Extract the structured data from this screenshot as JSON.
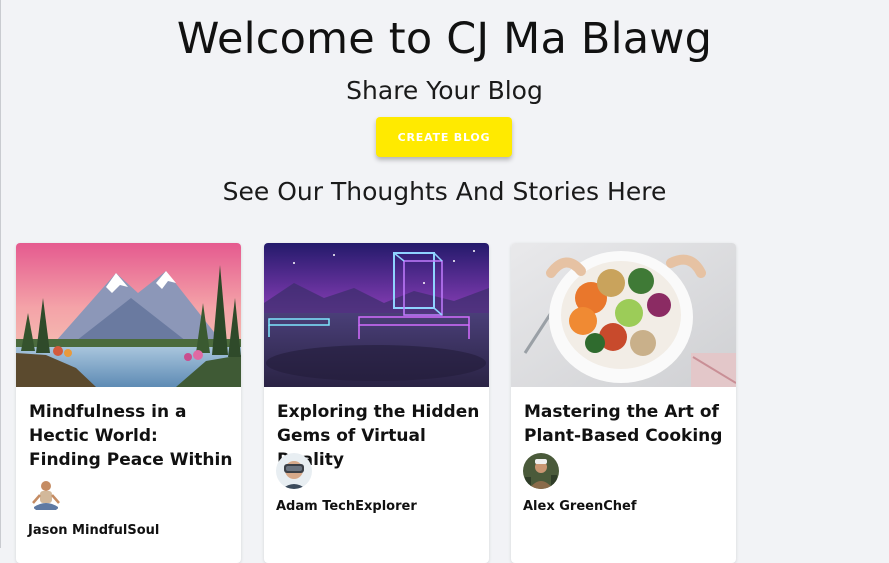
{
  "hero": {
    "title": "Welcome to CJ Ma Blawg",
    "subtitle": "Share Your Blog",
    "create_button_label": "CREATE BLOG",
    "section_heading": "See Our Thoughts And Stories Here"
  },
  "posts": [
    {
      "title": "Mindfulness in a Hectic World: Finding Peace Within",
      "author": "Jason MindfulSoul",
      "image": "mountain-lake-image",
      "avatar": "meditating-person-avatar"
    },
    {
      "title": "Exploring the Hidden Gems of Virtual Reality",
      "author": "Adam TechExplorer",
      "image": "neon-vr-landscape-image",
      "avatar": "vr-headset-avatar"
    },
    {
      "title": "Mastering the Art of Plant-Based Cooking",
      "author": "Alex GreenChef",
      "image": "salad-bowl-image",
      "avatar": "chef-avatar"
    }
  ],
  "colors": {
    "page_background": "#f2f3f6",
    "create_button": "#ffea00",
    "card_background": "#ffffff"
  }
}
